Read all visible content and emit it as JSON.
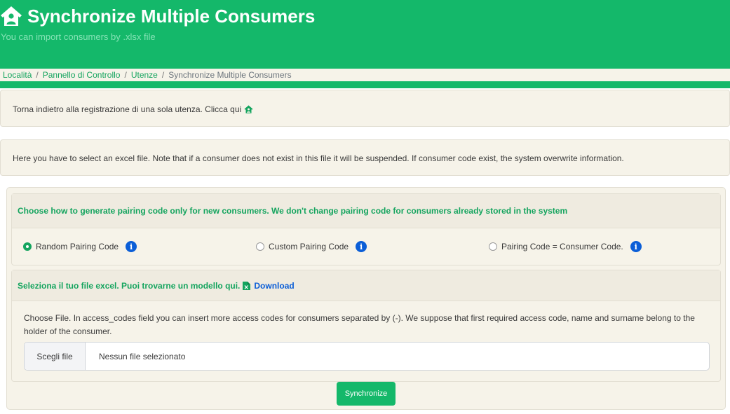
{
  "header": {
    "title": "Synchronize Multiple Consumers",
    "subtitle": "You can import consumers by .xlsx file",
    "icon": "house-user-icon"
  },
  "breadcrumb": {
    "items": [
      {
        "label": "Località",
        "link": true
      },
      {
        "label": "Pannello di Controllo",
        "link": true
      },
      {
        "label": "Utenze",
        "link": true
      },
      {
        "label": "Synchronize Multiple Consumers",
        "link": false
      }
    ],
    "separator": "/"
  },
  "back_notice": {
    "text": "Torna indietro alla registrazione di una sola utenza. Clicca qui",
    "icon": "house-user-icon"
  },
  "info_notice": {
    "text": "Here you have to select an excel file. Note that if a consumer does not exist in this file it will be suspended. If consumer code exist, the system overwrite information."
  },
  "pairing": {
    "heading": "Choose how to generate pairing code only for new consumers. We don't change pairing code for consumers already stored in the system",
    "options": [
      {
        "label": "Random Pairing Code",
        "checked": true,
        "icon": "info-icon"
      },
      {
        "label": "Custom Pairing Code",
        "checked": false,
        "icon": "info-icon"
      },
      {
        "label": "Pairing Code = Consumer Code.",
        "checked": false,
        "icon": "info-icon"
      }
    ]
  },
  "file_section": {
    "heading": "Seleziona il tuo file excel. Puoi trovarne un modello qui.",
    "download_label": "Download",
    "download_icon": "excel-file-icon",
    "description": "Choose File. In access_codes field you can insert more access codes for consumers separated by (-). We suppose that first required access code, name and surname belong to the holder of the consumer.",
    "choose_button": "Scegli file",
    "status": "Nessun file selezionato"
  },
  "actions": {
    "sync_label": "Synchronize"
  },
  "colors": {
    "brand_green": "#14b86a",
    "link_green": "#14a45e",
    "info_blue": "#0b5ed7",
    "panel_bg": "#f6f3e9"
  }
}
